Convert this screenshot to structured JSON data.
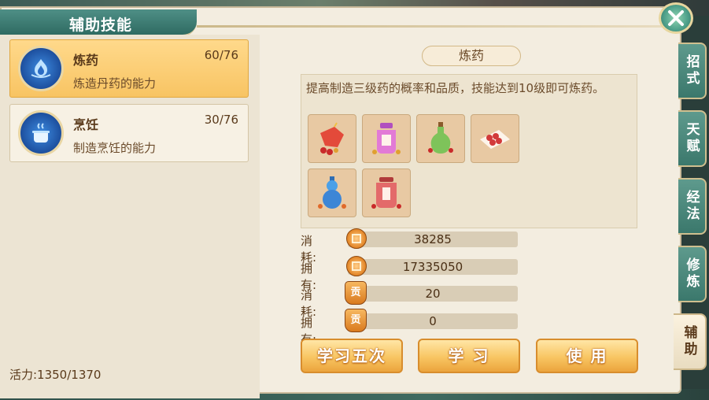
{
  "window": {
    "title": "辅助技能"
  },
  "skills": [
    {
      "name": "炼药",
      "level": "60/76",
      "desc": "炼造丹药的能力",
      "selected": true,
      "icon": "lotus-flame-icon"
    },
    {
      "name": "烹饪",
      "level": "30/76",
      "desc": "制造烹饪的能力",
      "selected": false,
      "icon": "cooking-pot-icon"
    }
  ],
  "energy": "活力:1350/1370",
  "detail": {
    "tab_label": "炼药",
    "description": "提高制造三级药的概率和品质，技能达到10级即可炼药。",
    "items": [
      {
        "icon": "red-pouch-icon"
      },
      {
        "icon": "purple-jar-icon"
      },
      {
        "icon": "green-vase-icon"
      },
      {
        "icon": "red-pills-plate-icon"
      },
      {
        "icon": "blue-gourd-icon"
      },
      {
        "icon": "red-jar-icon"
      }
    ]
  },
  "costs": [
    {
      "label": "消耗:",
      "value": "38285",
      "icon": "coin-icon"
    },
    {
      "label": "拥有:",
      "value": "17335050",
      "icon": "coin-icon"
    },
    {
      "label": "消耗:",
      "value": "20",
      "icon": "contribution-token-icon"
    },
    {
      "label": "拥有:",
      "value": "0",
      "icon": "contribution-token-icon"
    }
  ],
  "token_glyph": "贡",
  "buttons": {
    "learn_five": "学习五次",
    "learn": "学 习",
    "use": "使 用"
  },
  "side_tabs": [
    "招式",
    "天赋",
    "经法",
    "修炼",
    "辅助"
  ],
  "colors": {
    "accent": "#f8c562",
    "panel": "#f3ede0",
    "teal": "#3b786c"
  }
}
